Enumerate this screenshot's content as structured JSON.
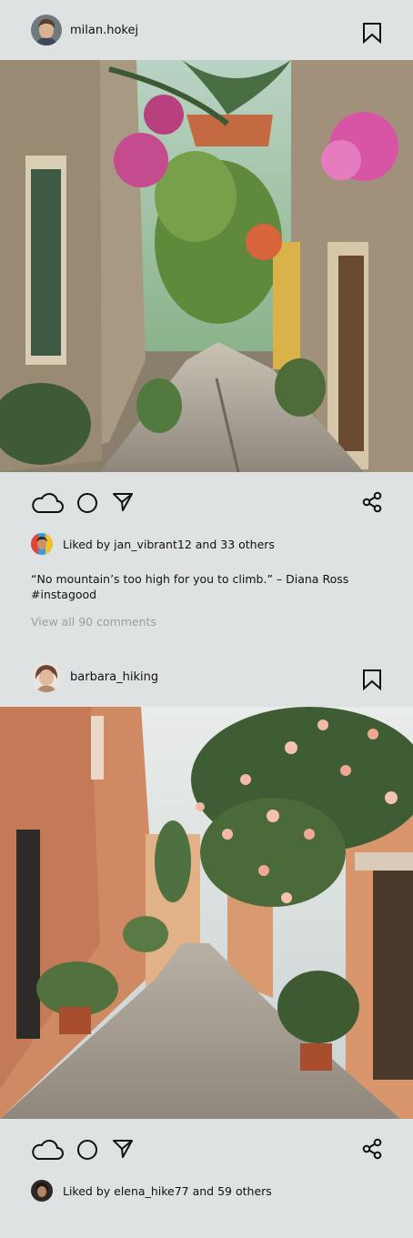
{
  "posts": [
    {
      "username": "milan.hokej",
      "liked_by_prefix": "Liked by ",
      "liked_by_user": "jan_vibrant12",
      "liked_by_suffix": " and 33 others",
      "caption_line1": "“No mountain’s too high for you to climb.” – Diana Ross",
      "caption_line2": "#instagood",
      "view_comments": "View all 90 comments"
    },
    {
      "username": "barbara_hiking",
      "liked_by_prefix": "Liked by ",
      "liked_by_user": "elena_hike77",
      "liked_by_suffix": " and 59 others"
    }
  ],
  "icons": {
    "like": "cloud-outline-icon",
    "comment": "circle-outline-icon",
    "send": "paper-plane-icon",
    "share": "share-icon",
    "save": "bookmark-icon"
  },
  "colors": {
    "background": "#dfe2e3",
    "text": "#111111",
    "muted_text": "#9a9ea1"
  }
}
